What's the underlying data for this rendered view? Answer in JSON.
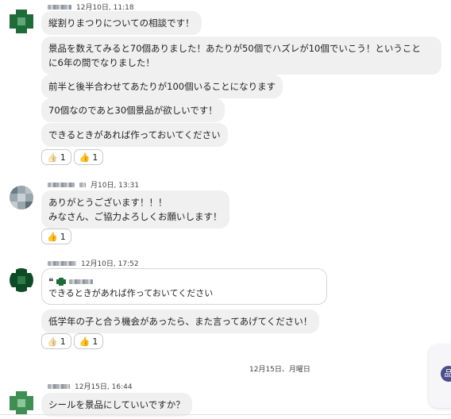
{
  "messages": [
    {
      "time": "12月10日, 11:18",
      "bubbles": [
        "縦割りまつりについての相談です！",
        "景品を数えてみると70個ありました！あたりが50個でハズレが10個でいこう！ということ\nに6年の間でなりました！",
        "前半と後半合わせてあたりが100個いることになります",
        "70個なのであと30個景品が欲しいです！",
        "できるときがあれば作っておいてください"
      ],
      "reactions": [
        {
          "emoji": "👍",
          "count": "1"
        },
        {
          "emoji": "👍",
          "count": "1"
        }
      ]
    },
    {
      "time": "月10日, 13:31",
      "bubbles": [
        "ありがとうございます！！！\nみなさん、ご協力よろしくお願いします！"
      ],
      "reactions": [
        {
          "emoji": "👍",
          "count": "1"
        }
      ]
    },
    {
      "time": "12月10日, 17:52",
      "quote": {
        "mark": "❝",
        "text": "できるときがあれば作っておいてください"
      },
      "bubbles": [
        "低学年の子と合う機会があったら、また言ってあげてください！"
      ],
      "reactions": [
        {
          "emoji": "👍",
          "count": "1"
        },
        {
          "emoji": "👍",
          "count": "1"
        }
      ]
    },
    {
      "time": "12月15日, 16:44",
      "bubbles": [
        "シールを景品にしていいですか？"
      ]
    }
  ],
  "date_separator": "12月15日、月曜日",
  "side_widget_icon": "スペースアイコン",
  "colors": {
    "bubble_bg": "#f0f0f0",
    "avatar_green": "#1f6b3a",
    "avatar_gray": "#7d8c96",
    "widget_circle": "#4a4e8c"
  }
}
